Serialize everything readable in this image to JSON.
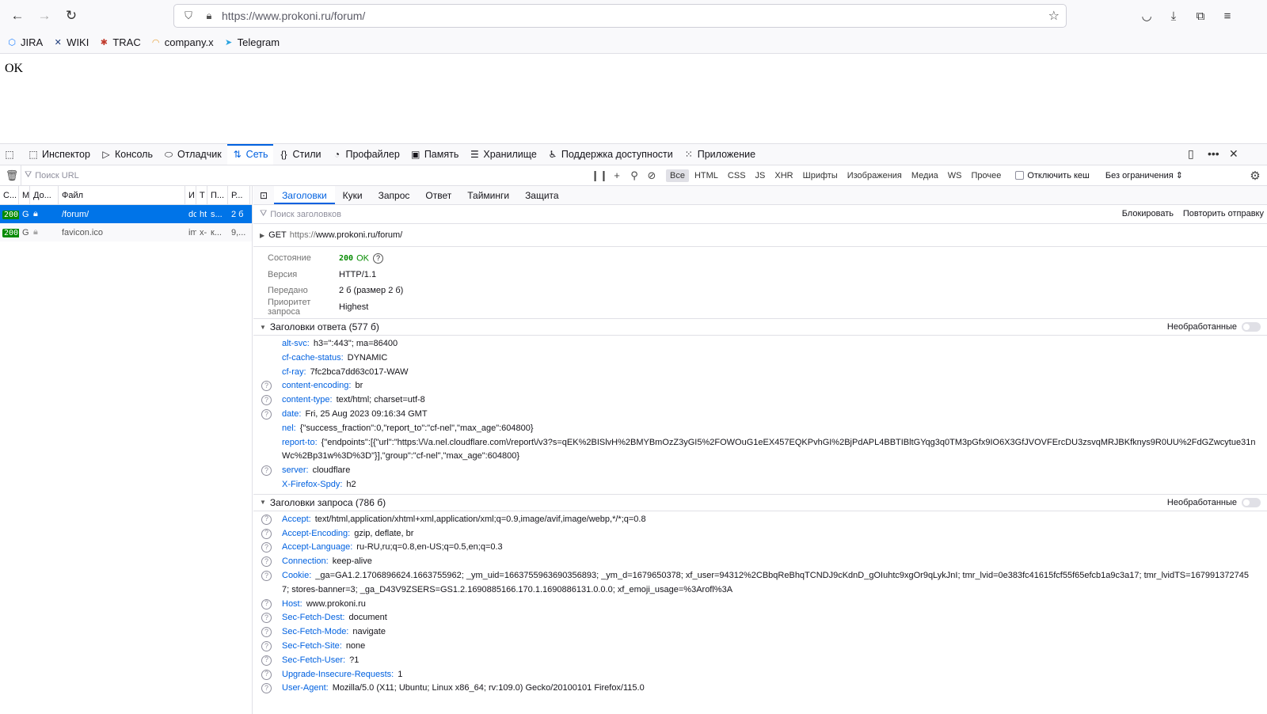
{
  "browser": {
    "url": "https://www.prokoni.ru/forum/",
    "bookmarks": [
      {
        "label": "JIRA",
        "icon": "jira-icon",
        "color": "#2684ff"
      },
      {
        "label": "WIKI",
        "icon": "wiki-icon",
        "color": "#1b3a7a"
      },
      {
        "label": "TRAC",
        "icon": "trac-icon",
        "color": "#c0392b"
      },
      {
        "label": "company.x",
        "icon": "company-icon",
        "color": "#e8a13a"
      },
      {
        "label": "Telegram",
        "icon": "telegram-icon",
        "color": "#2aa3e0"
      }
    ]
  },
  "page": {
    "body_text": "OK"
  },
  "devtools": {
    "tabs": [
      {
        "label": "Инспектор",
        "icon": "inspector-icon"
      },
      {
        "label": "Консоль",
        "icon": "console-icon"
      },
      {
        "label": "Отладчик",
        "icon": "debugger-icon"
      },
      {
        "label": "Сеть",
        "icon": "network-icon",
        "active": true
      },
      {
        "label": "Стили",
        "icon": "style-editor-icon"
      },
      {
        "label": "Профайлер",
        "icon": "profiler-icon"
      },
      {
        "label": "Память",
        "icon": "memory-icon"
      },
      {
        "label": "Хранилище",
        "icon": "storage-icon"
      },
      {
        "label": "Поддержка доступности",
        "icon": "accessibility-icon"
      },
      {
        "label": "Приложение",
        "icon": "application-icon"
      }
    ],
    "network": {
      "filter_placeholder": "Поиск URL",
      "types": [
        "Все",
        "HTML",
        "CSS",
        "JS",
        "XHR",
        "Шрифты",
        "Изображения",
        "Медиа",
        "WS",
        "Прочее"
      ],
      "disable_cache": "Отключить кеш",
      "throttling": "Без ограничения ⇕",
      "columns": [
        "С...",
        "М",
        "До...",
        "Файл",
        "И",
        "Т",
        "П...",
        "Р..."
      ],
      "requests": [
        {
          "status": "200",
          "method": "G",
          "file": "/forum/",
          "initiator": "dc",
          "type": "ht",
          "transferred": "s...",
          "size": "2 б"
        },
        {
          "status": "200",
          "method": "G",
          "file": "favicon.ico",
          "initiator": "im",
          "type": "x-",
          "transferred": "к...",
          "size": "9,..."
        }
      ]
    },
    "details": {
      "tabs": [
        "Заголовки",
        "Куки",
        "Запрос",
        "Ответ",
        "Тайминги",
        "Защита"
      ],
      "filter_placeholder": "Поиск заголовков",
      "block": "Блокировать",
      "resend": "Повторить отправку",
      "method": "GET",
      "scheme": "https://",
      "url_rest": "www.prokoni.ru/forum/",
      "summary": [
        {
          "label": "Состояние",
          "value": "OK",
          "code": "200"
        },
        {
          "label": "Версия",
          "value": "HTTP/1.1"
        },
        {
          "label": "Передано",
          "value": "2 б (размер 2 б)"
        },
        {
          "label": "Приоритет запроса",
          "value": "Highest"
        }
      ],
      "raw_label": "Необработанные",
      "response_title": "Заголовки ответа (577 б)",
      "response_headers": [
        {
          "name": "alt-svc:",
          "value": "h3=\":443\"; ma=86400",
          "help": false
        },
        {
          "name": "cf-cache-status:",
          "value": "DYNAMIC",
          "help": false
        },
        {
          "name": "cf-ray:",
          "value": "7fc2bca7dd63c017-WAW",
          "help": false
        },
        {
          "name": "content-encoding:",
          "value": "br",
          "help": true
        },
        {
          "name": "content-type:",
          "value": "text/html; charset=utf-8",
          "help": true
        },
        {
          "name": "date:",
          "value": "Fri, 25 Aug 2023 09:16:34 GMT",
          "help": true
        },
        {
          "name": "nel:",
          "value": "{\"success_fraction\":0,\"report_to\":\"cf-nel\",\"max_age\":604800}",
          "help": false
        },
        {
          "name": "report-to:",
          "value": "{\"endpoints\":[{\"url\":\"https:\\/\\/a.nel.cloudflare.com\\/report\\/v3?s=qEK%2BISlvH%2BMYBmOzZ3yGI5%2FOWOuG1eEX457EQKPvhGI%2BjPdAPL4BBTIBltGYqg3q0TM3pGfx9IO6X3GfJVOVFErcDU3zsvqMRJBKfknys9R0UU%2FdGZwcytue31nWc%2Bp31w%3D%3D\"}],\"group\":\"cf-nel\",\"max_age\":604800}",
          "help": false,
          "wrap": true
        },
        {
          "name": "server:",
          "value": "cloudflare",
          "help": true
        },
        {
          "name": "X-Firefox-Spdy:",
          "value": "h2",
          "help": false
        }
      ],
      "request_title": "Заголовки запроса (786 б)",
      "request_headers": [
        {
          "name": "Accept:",
          "value": "text/html,application/xhtml+xml,application/xml;q=0.9,image/avif,image/webp,*/*;q=0.8",
          "help": true
        },
        {
          "name": "Accept-Encoding:",
          "value": "gzip, deflate, br",
          "help": true
        },
        {
          "name": "Accept-Language:",
          "value": "ru-RU,ru;q=0.8,en-US;q=0.5,en;q=0.3",
          "help": true
        },
        {
          "name": "Connection:",
          "value": "keep-alive",
          "help": true
        },
        {
          "name": "Cookie:",
          "value": "_ga=GA1.2.1706896624.1663755962; _ym_uid=1663755963690356893; _ym_d=1679650378; xf_user=94312%2CBbqReBhqTCNDJ9cKdnD_gOIuhtc9xgOr9qLykJnI; tmr_lvid=0e383fc41615fcf55f65efcb1a9c3a17; tmr_lvidTS=1679913727457; stores-banner=3; _ga_D43V9ZSERS=GS1.2.1690885166.170.1.1690886131.0.0.0; xf_emoji_usage=%3Arofl%3A",
          "help": true,
          "wrap": true
        },
        {
          "name": "Host:",
          "value": "www.prokoni.ru",
          "help": true
        },
        {
          "name": "Sec-Fetch-Dest:",
          "value": "document",
          "help": true
        },
        {
          "name": "Sec-Fetch-Mode:",
          "value": "navigate",
          "help": true
        },
        {
          "name": "Sec-Fetch-Site:",
          "value": "none",
          "help": true
        },
        {
          "name": "Sec-Fetch-User:",
          "value": "?1",
          "help": true
        },
        {
          "name": "Upgrade-Insecure-Requests:",
          "value": "1",
          "help": true
        },
        {
          "name": "User-Agent:",
          "value": "Mozilla/5.0 (X11; Ubuntu; Linux x86_64; rv:109.0) Gecko/20100101 Firefox/115.0",
          "help": true
        }
      ]
    }
  }
}
